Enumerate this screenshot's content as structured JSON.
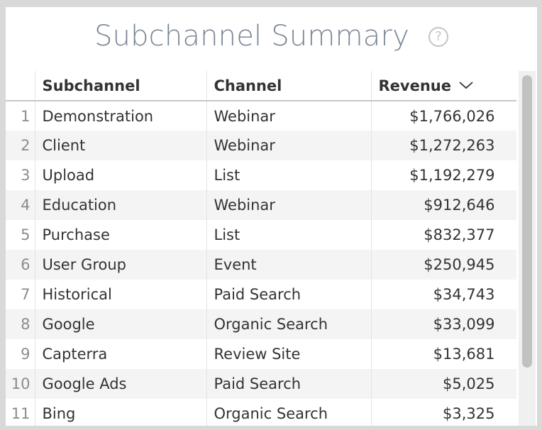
{
  "widget": {
    "title": "Subchannel Summary",
    "help_icon": "help-circle-icon",
    "help_symbol": "?"
  },
  "table": {
    "columns": [
      "Subchannel",
      "Channel",
      "Revenue"
    ],
    "sort": {
      "column": "Revenue",
      "direction": "descending",
      "icon": "chevron-down-icon"
    },
    "rows": [
      {
        "index": "1",
        "subchannel": "Demonstration",
        "channel": "Webinar",
        "revenue": "$1,766,026"
      },
      {
        "index": "2",
        "subchannel": "Client",
        "channel": "Webinar",
        "revenue": "$1,272,263"
      },
      {
        "index": "3",
        "subchannel": "Upload",
        "channel": "List",
        "revenue": "$1,192,279"
      },
      {
        "index": "4",
        "subchannel": "Education",
        "channel": "Webinar",
        "revenue": "$912,646"
      },
      {
        "index": "5",
        "subchannel": "Purchase",
        "channel": "List",
        "revenue": "$832,377"
      },
      {
        "index": "6",
        "subchannel": "User Group",
        "channel": "Event",
        "revenue": "$250,945"
      },
      {
        "index": "7",
        "subchannel": "Historical",
        "channel": "Paid Search",
        "revenue": "$34,743"
      },
      {
        "index": "8",
        "subchannel": "Google",
        "channel": "Organic Search",
        "revenue": "$33,099"
      },
      {
        "index": "9",
        "subchannel": "Capterra",
        "channel": "Review Site",
        "revenue": "$13,681"
      },
      {
        "index": "10",
        "subchannel": "Google Ads",
        "channel": "Paid Search",
        "revenue": "$5,025"
      },
      {
        "index": "11",
        "subchannel": "Bing",
        "channel": "Organic Search",
        "revenue": "$3,325"
      }
    ]
  },
  "colors": {
    "title": "#7b8797",
    "stripe": "#f4f4f4",
    "scrollbar_thumb": "#c1c1c1"
  }
}
